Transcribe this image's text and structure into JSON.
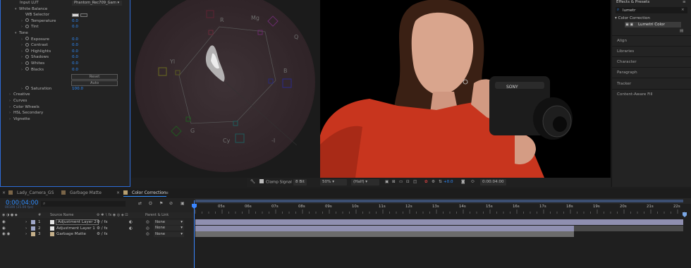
{
  "effect_controls": {
    "input_lut": {
      "label": "Input LUT",
      "value": "Phantom_Rec709_Gam"
    },
    "white_balance": {
      "label": "White Balance",
      "selector_label": "WB Selector"
    },
    "temperature": {
      "label": "Temperature",
      "value": "0.0"
    },
    "tint": {
      "label": "Tint",
      "value": "0.0"
    },
    "tone_label": "Tone",
    "exposure": {
      "label": "Exposure",
      "value": "0.0"
    },
    "contrast": {
      "label": "Contrast",
      "value": "0.0"
    },
    "highlights": {
      "label": "Highlights",
      "value": "0.0"
    },
    "shadows": {
      "label": "Shadows",
      "value": "0.0"
    },
    "whites": {
      "label": "Whites",
      "value": "0.0"
    },
    "blacks": {
      "label": "Blacks",
      "value": "0.0"
    },
    "reset_label": "Reset",
    "auto_label": "Auto",
    "saturation": {
      "label": "Saturation",
      "value": "100.0"
    },
    "sections": [
      "Creative",
      "Curves",
      "Color Wheels",
      "HSL Secondary",
      "Vignette"
    ]
  },
  "vectorscope": {
    "labels": {
      "r": "R",
      "mg": "Mg",
      "q": "Q",
      "b": "B",
      "yl": "Yl",
      "g": "G",
      "cy": "Cy",
      "i": "-I"
    }
  },
  "viewer": {
    "clamp_signal_label": "Clamp Signal",
    "bit_depth": "8 Bit",
    "zoom": "50%",
    "resolution": "(Half)",
    "exposure_value": "+0.0",
    "timecode": "0:00:04:00"
  },
  "effects_presets": {
    "title": "Effects & Presets",
    "search_value": "lumetr",
    "category": "Color Correction",
    "effect_item": "Lumetri Color",
    "panels": [
      "Align",
      "Libraries",
      "Character",
      "Paragraph",
      "Tracker",
      "Content-Aware Fill"
    ]
  },
  "timeline": {
    "tabs": [
      "Lady_Camera_GS",
      "Garbage Matte",
      "Color Correction"
    ],
    "tab_colors": [
      "#7a6548",
      "#7a6548",
      "#b8a070"
    ],
    "current_time": "0:00:04:00",
    "frame_info": "00100 (25.00 fps)",
    "search_placeholder": "",
    "col_source_name": "Source Name",
    "col_parent": "Parent & Link",
    "col_hash": "#",
    "layers": [
      {
        "num": "1",
        "name": "Adjustment Layer 2",
        "parent": "None",
        "color": "#9fa7c9"
      },
      {
        "num": "2",
        "name": "Adjustment Layer 1",
        "parent": "None",
        "color": "#9fa7c9"
      },
      {
        "num": "3",
        "name": "Garbage Matte",
        "parent": "None",
        "color": "#c5b08a"
      }
    ],
    "ruler": [
      "05s",
      "06s",
      "07s",
      "08s",
      "09s",
      "10s",
      "11s",
      "12s",
      "13s",
      "14s",
      "15s",
      "16s",
      "17s",
      "18s",
      "19s",
      "20s",
      "21s",
      "22s"
    ]
  },
  "colors": {
    "accent_blue": "#2f8dff",
    "layer_bar": "#8f8fb0",
    "layer_bar_gray": "#6c6c6c",
    "playhead": "#3a86ff"
  }
}
